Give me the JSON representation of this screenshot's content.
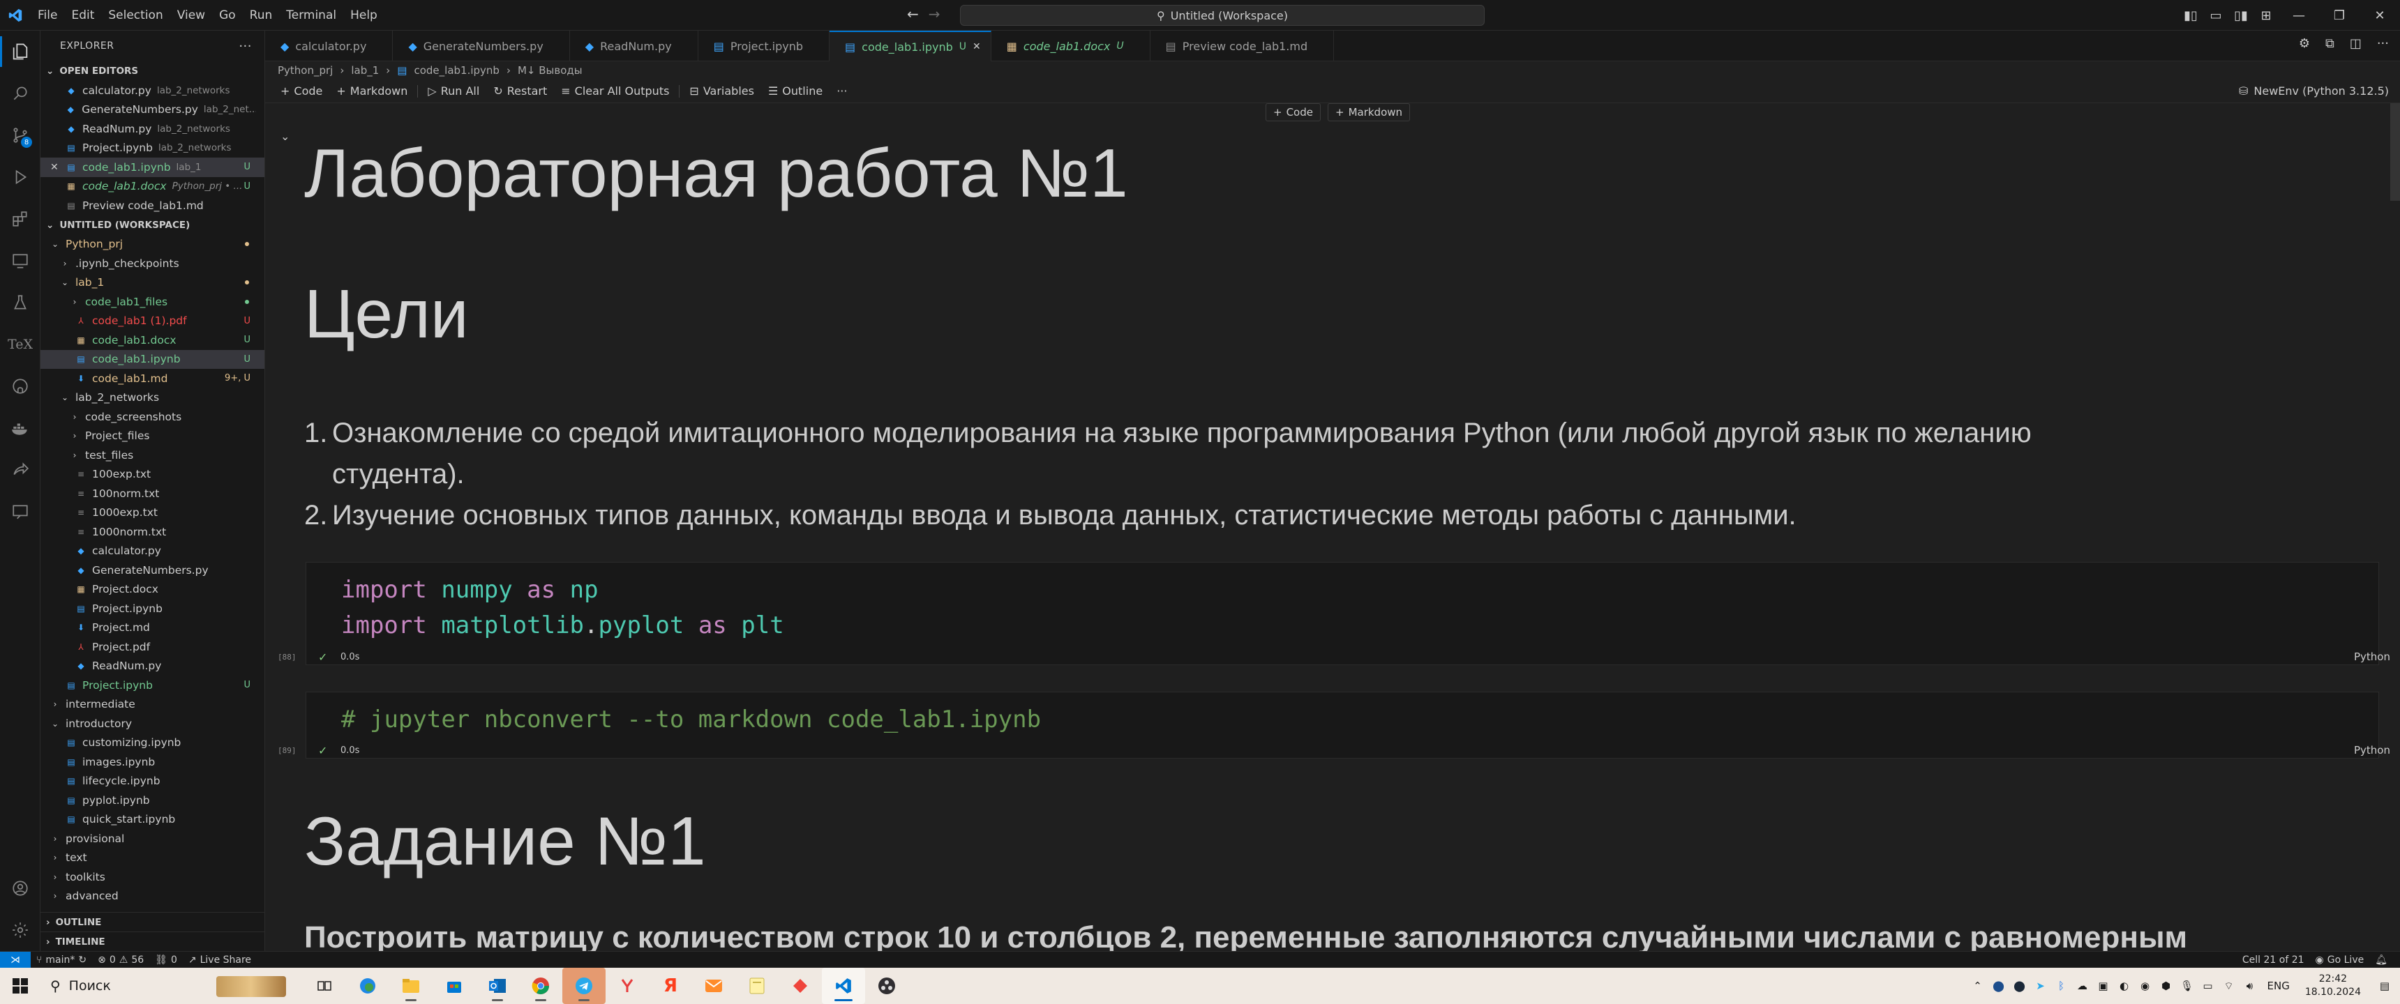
{
  "window": {
    "menu": [
      "File",
      "Edit",
      "Selection",
      "View",
      "Go",
      "Run",
      "Terminal",
      "Help"
    ],
    "command_center": "Untitled (Workspace)"
  },
  "sidebar": {
    "title": "EXPLORER",
    "open_editors_title": "OPEN EDITORS",
    "open_editors": [
      {
        "name": "calculator.py",
        "desc": "lab_2_networks",
        "icon": "python-icon",
        "status": ""
      },
      {
        "name": "GenerateNumbers.py",
        "desc": "lab_2_net...",
        "icon": "python-icon",
        "status": ""
      },
      {
        "name": "ReadNum.py",
        "desc": "lab_2_networks",
        "icon": "python-icon",
        "status": ""
      },
      {
        "name": "Project.ipynb",
        "desc": "lab_2_networks",
        "icon": "notebook-icon",
        "status": ""
      },
      {
        "name": "code_lab1.ipynb",
        "desc": "lab_1",
        "icon": "notebook-icon",
        "status": "U"
      },
      {
        "name": "code_lab1.docx",
        "desc": "Python_prj • ...",
        "icon": "word-icon",
        "status": "U"
      },
      {
        "name": "Preview code_lab1.md",
        "desc": "",
        "icon": "preview-icon",
        "status": ""
      }
    ],
    "workspace_title": "UNTITLED (WORKSPACE)",
    "tree": [
      {
        "name": "Python_prj",
        "level": 0,
        "type": "folder-open",
        "status": "dot"
      },
      {
        "name": ".ipynb_checkpoints",
        "level": 1,
        "type": "folder",
        "status": ""
      },
      {
        "name": "lab_1",
        "level": 1,
        "type": "folder-open",
        "status": "dot"
      },
      {
        "name": "code_lab1_files",
        "level": 2,
        "type": "folder",
        "status": "dot"
      },
      {
        "name": "code_lab1 (1).pdf",
        "level": 2,
        "type": "pdf",
        "status": "U"
      },
      {
        "name": "code_lab1.docx",
        "level": 2,
        "type": "word",
        "status": "U"
      },
      {
        "name": "code_lab1.ipynb",
        "level": 2,
        "type": "notebook",
        "status": "U"
      },
      {
        "name": "code_lab1.md",
        "level": 2,
        "type": "md",
        "status": "9+, U"
      },
      {
        "name": "lab_2_networks",
        "level": 1,
        "type": "folder-open",
        "status": ""
      },
      {
        "name": "code_screenshots",
        "level": 2,
        "type": "folder",
        "status": ""
      },
      {
        "name": "Project_files",
        "level": 2,
        "type": "folder",
        "status": ""
      },
      {
        "name": "test_files",
        "level": 2,
        "type": "folder",
        "status": ""
      },
      {
        "name": "100exp.txt",
        "level": 2,
        "type": "txt",
        "status": ""
      },
      {
        "name": "100norm.txt",
        "level": 2,
        "type": "txt",
        "status": ""
      },
      {
        "name": "1000exp.txt",
        "level": 2,
        "type": "txt",
        "status": ""
      },
      {
        "name": "1000norm.txt",
        "level": 2,
        "type": "txt",
        "status": ""
      },
      {
        "name": "calculator.py",
        "level": 2,
        "type": "python",
        "status": ""
      },
      {
        "name": "GenerateNumbers.py",
        "level": 2,
        "type": "python",
        "status": ""
      },
      {
        "name": "Project.docx",
        "level": 2,
        "type": "word",
        "status": ""
      },
      {
        "name": "Project.ipynb",
        "level": 2,
        "type": "notebook",
        "status": ""
      },
      {
        "name": "Project.md",
        "level": 2,
        "type": "md",
        "status": ""
      },
      {
        "name": "Project.pdf",
        "level": 2,
        "type": "pdf",
        "status": ""
      },
      {
        "name": "ReadNum.py",
        "level": 2,
        "type": "python",
        "status": ""
      },
      {
        "name": "Project.ipynb",
        "level": 1,
        "type": "notebook",
        "status": "U"
      },
      {
        "name": "intermediate",
        "level": 0,
        "type": "folder",
        "status": ""
      },
      {
        "name": "introductory",
        "level": 0,
        "type": "folder-open",
        "status": ""
      },
      {
        "name": "customizing.ipynb",
        "level": 1,
        "type": "notebook",
        "status": ""
      },
      {
        "name": "images.ipynb",
        "level": 1,
        "type": "notebook",
        "status": ""
      },
      {
        "name": "lifecycle.ipynb",
        "level": 1,
        "type": "notebook",
        "status": ""
      },
      {
        "name": "pyplot.ipynb",
        "level": 1,
        "type": "notebook",
        "status": ""
      },
      {
        "name": "quick_start.ipynb",
        "level": 1,
        "type": "notebook",
        "status": ""
      },
      {
        "name": "provisional",
        "level": 0,
        "type": "folder",
        "status": ""
      },
      {
        "name": "text",
        "level": 0,
        "type": "folder",
        "status": ""
      },
      {
        "name": "toolkits",
        "level": 0,
        "type": "folder",
        "status": ""
      },
      {
        "name": "advanced",
        "level": 0,
        "type": "folder",
        "status": ""
      }
    ],
    "outline_title": "OUTLINE",
    "timeline_title": "TIMELINE"
  },
  "tabs": [
    {
      "label": "calculator.py",
      "icon": "python-icon",
      "status": "",
      "active": false,
      "italic": false
    },
    {
      "label": "GenerateNumbers.py",
      "icon": "python-icon",
      "status": "",
      "active": false,
      "italic": false
    },
    {
      "label": "ReadNum.py",
      "icon": "python-icon",
      "status": "",
      "active": false,
      "italic": false
    },
    {
      "label": "Project.ipynb",
      "icon": "notebook-icon",
      "status": "",
      "active": false,
      "italic": false
    },
    {
      "label": "code_lab1.ipynb",
      "icon": "notebook-icon",
      "status": "U",
      "active": true,
      "italic": false
    },
    {
      "label": "code_lab1.docx",
      "icon": "word-icon",
      "status": "U",
      "active": false,
      "italic": true
    },
    {
      "label": "Preview code_lab1.md",
      "icon": "preview-icon",
      "status": "",
      "active": false,
      "italic": false
    }
  ],
  "breadcrumbs": [
    "Python_prj",
    "lab_1",
    "code_lab1.ipynb",
    "M↓ Выводы"
  ],
  "toolbar": {
    "code": "Code",
    "markdown": "Markdown",
    "run_all": "Run All",
    "restart": "Restart",
    "clear_all": "Clear All Outputs",
    "variables": "Variables",
    "outline": "Outline",
    "more": "···",
    "kernel": "NewEnv (Python 3.12.5)"
  },
  "notebook": {
    "insert_code": "Code",
    "insert_markdown": "Markdown",
    "title": "Лабораторная работа №1",
    "goals_heading": "Цели",
    "goals": [
      {
        "num": "1.",
        "text": "Ознакомление со средой имитационного моделирования на языке программирования Python (или любой другой язык по желанию",
        "cont": "студента)."
      },
      {
        "num": "2.",
        "text": "Изучение основных типов данных, команды ввода и вывода данных, статистические методы работы с данными.",
        "cont": ""
      }
    ],
    "cell1": {
      "exec": "[88]",
      "line1": {
        "kw1": "import",
        "mod": "numpy",
        "kw2": "as",
        "alias": "np"
      },
      "line2": {
        "kw1": "import",
        "mod": "matplotlib",
        "dot": ".",
        "sub": "pyplot",
        "kw2": "as",
        "alias": "plt"
      },
      "time": "0.0s",
      "lang": "Python"
    },
    "cell2": {
      "exec": "[89]",
      "hash": "#",
      "comment": "jupyter nbconvert --to markdown code_lab1.ipynb",
      "time": "0.0s",
      "lang": "Python"
    },
    "task_heading": "Задание №1",
    "task_text": "Построить матрицу с количеством строк 10 и столбцов 2, переменные заполняются случайными числами с равномерным"
  },
  "statusbar": {
    "branch": "main*",
    "errors": "0",
    "warnings": "56",
    "ports": "0",
    "live_share": "Live Share",
    "cell_pos": "Cell 21 of 21",
    "go_live": "Go Live"
  },
  "taskbar": {
    "search": "Поиск",
    "lang": "ENG",
    "time": "22:42",
    "date": "18.10.2024"
  },
  "colors": {
    "accent": "#0078d4",
    "untracked": "#73c991",
    "modified": "#e2c08d",
    "pdf": "#f14c4c"
  }
}
